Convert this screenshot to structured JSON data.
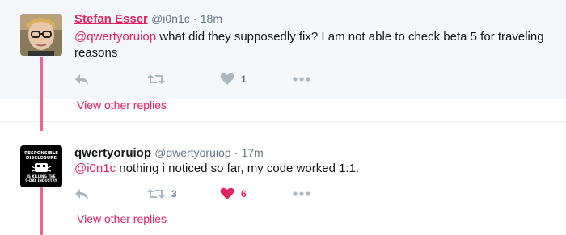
{
  "tweets": [
    {
      "display_name": "Stefan Esser",
      "username": "@i0n1c",
      "separator": "·",
      "time": "18m",
      "mention": "@qwertyoruiop",
      "text": " what did they supposedly fix? I am not able to check beta 5 for traveling reasons",
      "reply_count": "",
      "retweet_count": "",
      "like_count": "1",
      "liked": false,
      "view_replies": "View other replies"
    },
    {
      "display_name": "qwertyoruiop",
      "username": "@qwertyoruiop",
      "separator": "·",
      "time": "17m",
      "mention": "@i0n1c",
      "text": " nothing i noticed so far, my code worked 1:1.",
      "reply_count": "",
      "retweet_count": "3",
      "like_count": "6",
      "liked": true,
      "view_replies": "View other replies",
      "avatar_text": [
        "RESPONSIBLE",
        "DISCLOSURE",
        "IS KILLING THE",
        "0-DAY INDUSTRY"
      ]
    }
  ],
  "colors": {
    "accent": "#e0245e",
    "thread_line": "#e8668f",
    "muted": "#657786",
    "text": "#14171a",
    "highlight_bg": "#f5f8fa",
    "icon": "#aab8c2"
  },
  "icons": {
    "reply": "reply-icon",
    "retweet": "retweet-icon",
    "like": "heart-icon",
    "more": "more-dots-icon"
  }
}
